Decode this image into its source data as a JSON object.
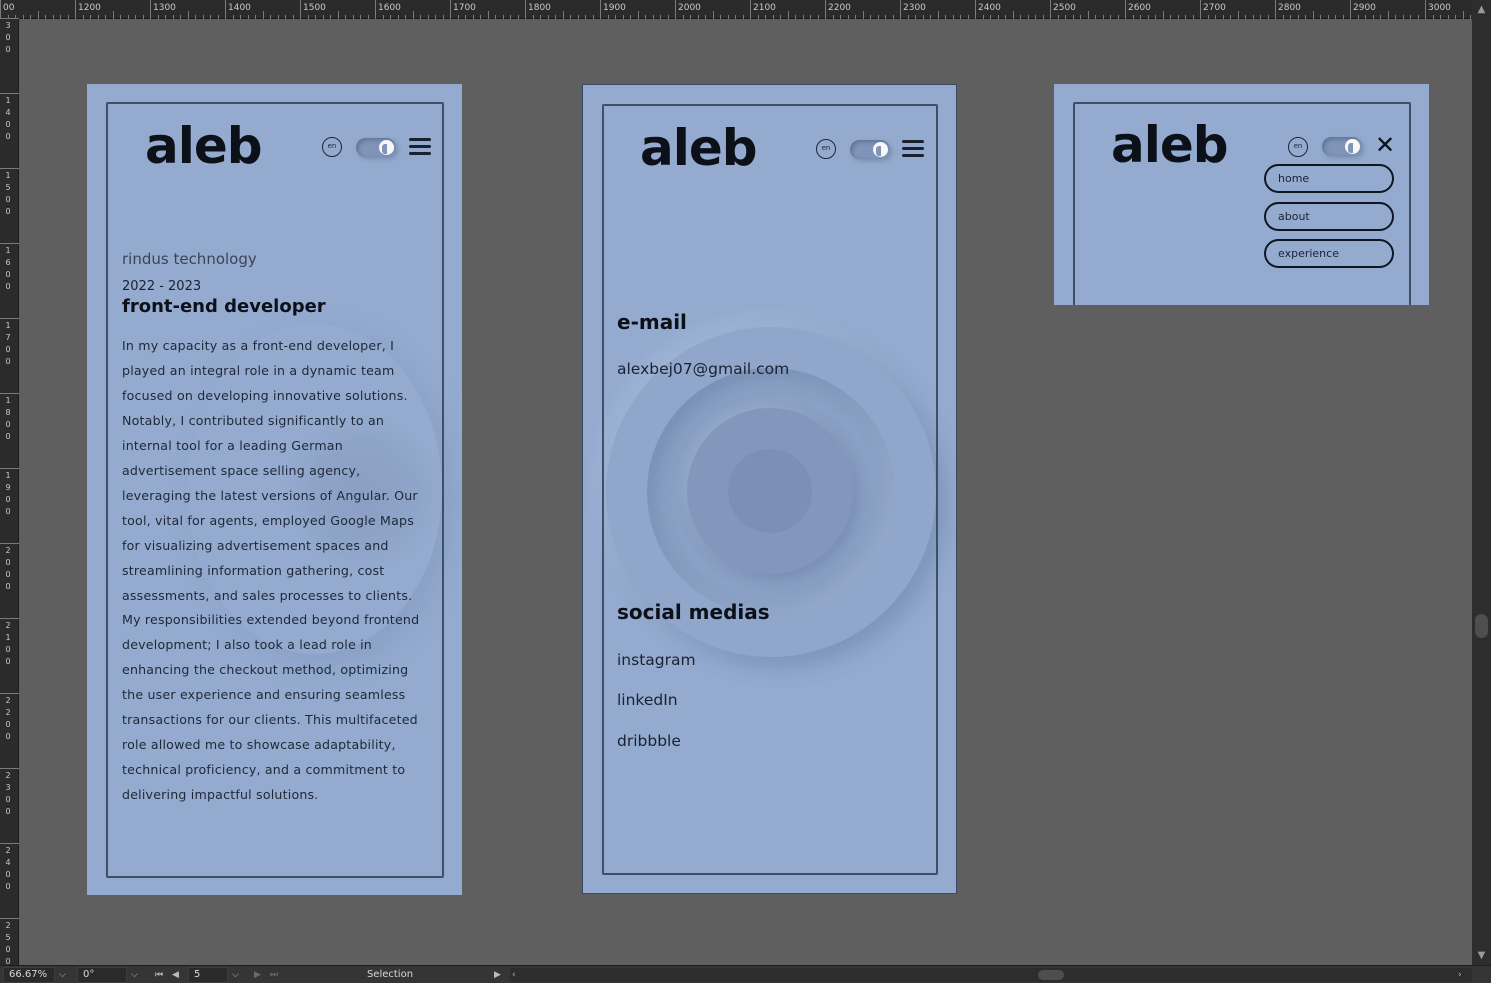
{
  "ruler": {
    "top_labels": [
      "00",
      "1200",
      "1300",
      "1400",
      "1500",
      "1600",
      "1700",
      "1800",
      "1900",
      "2000",
      "2100",
      "2200",
      "2300",
      "2400",
      "2500",
      "2600",
      "2700",
      "2800",
      "2900",
      "3000"
    ],
    "left_labels": [
      "300",
      "1400",
      "1500",
      "1600",
      "1700",
      "1800",
      "1900",
      "2000",
      "2100",
      "2200",
      "2300",
      "2400",
      "2500"
    ]
  },
  "statusbar": {
    "zoom": "66.67%",
    "rotation": "0°",
    "page": "5",
    "tool": "Selection"
  },
  "artboard1": {
    "logo": "aleb",
    "lang": "en",
    "company": "rindus technology",
    "years": "2022 - 2023",
    "role": "front-end developer",
    "description": "In my capacity as a front-end developer, I played an integral role in a dynamic team focused on developing innovative solutions. Notably, I contributed significantly to an internal tool for a leading German advertisement space selling agency, leveraging the latest versions of Angular. Our tool, vital for agents, employed Google Maps for visualizing advertisement spaces and streamlining information gathering, cost assessments, and sales processes to clients. My responsibilities extended beyond frontend development; I also took a lead role in enhancing the checkout method, optimizing the user experience and ensuring seamless transactions for our clients. This multifaceted role allowed me to showcase adaptability, technical proficiency, and a commitment to delivering impactful solutions."
  },
  "artboard2": {
    "logo": "aleb",
    "lang": "en",
    "email_heading": "e-mail",
    "email": "alexbej07@gmail.com",
    "social_heading": "social medias",
    "social_links": [
      "instagram",
      "linkedIn",
      "dribbble"
    ]
  },
  "artboard3": {
    "logo": "aleb",
    "lang": "en",
    "menu": [
      "home",
      "about",
      "experience"
    ]
  },
  "colors": {
    "canvas": "#5f5f5f",
    "artboard": "#94abcf",
    "frame": "#3f4f66",
    "text_dark": "#0c1018"
  }
}
